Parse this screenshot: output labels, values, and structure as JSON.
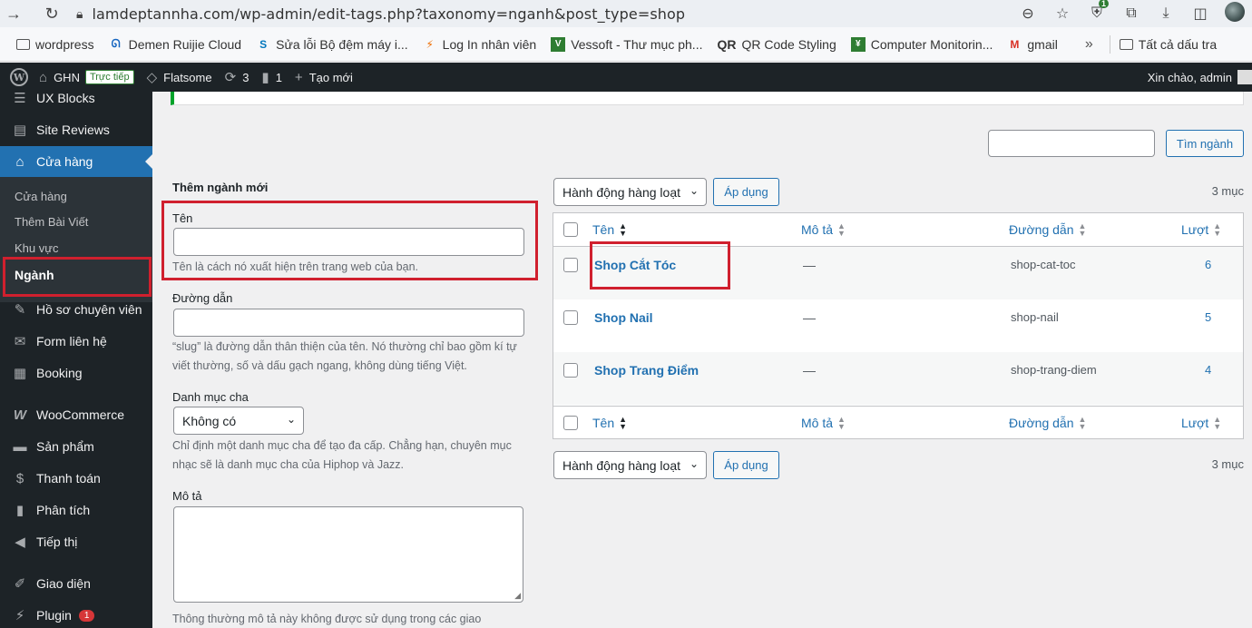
{
  "browser": {
    "url": "lamdeptannha.com/wp-admin/edit-tags.php?taxonomy=nganh&post_type=shop",
    "ext_badge": "1",
    "bookmarks": [
      {
        "label": "wordpress",
        "icon": "folder-icon"
      },
      {
        "label": "Demen Ruijie Cloud",
        "icon": "ruijie-icon"
      },
      {
        "label": "Sửa lỗi Bộ đệm máy i...",
        "icon": "s-logo-icon"
      },
      {
        "label": "Log In nhân viên",
        "icon": "bolt-icon"
      },
      {
        "label": "Vessoft - Thư mục ph...",
        "icon": "vessoft-icon"
      },
      {
        "label": "QR Code Styling",
        "icon": "qr-icon"
      },
      {
        "label": "Computer Monitorin...",
        "icon": "monitor-icon"
      },
      {
        "label": "gmail",
        "icon": "gmail-icon"
      }
    ],
    "bookmarks_more": "»",
    "all_bookmarks": "Tất cả dấu tra"
  },
  "adminbar": {
    "site_name": "GHN",
    "live_label": "Trực tiếp",
    "theme": "Flatsome",
    "updates": "3",
    "comments": "1",
    "new_label": "Tạo mới",
    "howdy": "Xin chào, admin"
  },
  "sidebar": {
    "items": [
      {
        "label": "UX Blocks",
        "icon": "blocks-icon"
      },
      {
        "label": "Site Reviews",
        "icon": "reviews-icon"
      },
      {
        "label": "Cửa hàng",
        "icon": "store-icon"
      },
      {
        "label": "Hồ sơ chuyên viên",
        "icon": "pin-icon"
      },
      {
        "label": "Form liên hệ",
        "icon": "mail-icon"
      },
      {
        "label": "Booking",
        "icon": "calendar-icon"
      },
      {
        "label": "WooCommerce",
        "icon": "woo-icon"
      },
      {
        "label": "Sản phẩm",
        "icon": "archive-icon"
      },
      {
        "label": "Thanh toán",
        "icon": "dollar-icon"
      },
      {
        "label": "Phân tích",
        "icon": "chart-icon"
      },
      {
        "label": "Tiếp thị",
        "icon": "megaphone-icon"
      },
      {
        "label": "Giao diện",
        "icon": "brush-icon"
      },
      {
        "label": "Plugin",
        "icon": "plugin-icon"
      }
    ],
    "plugin_badge": "1",
    "submenu": [
      "Cửa hàng",
      "Thêm Bài Viết",
      "Khu vực",
      "Ngành"
    ]
  },
  "form": {
    "title": "Thêm ngành mới",
    "name_label": "Tên",
    "name_value": "",
    "name_desc": "Tên là cách nó xuất hiện trên trang web của bạn.",
    "slug_label": "Đường dẫn",
    "slug_value": "",
    "slug_desc": "“slug” là đường dẫn thân thiện của tên. Nó thường chỉ bao gồm kí tự viết thường, số và dấu gạch ngang, không dùng tiếng Việt.",
    "parent_label": "Danh mục cha",
    "parent_value": "Không có",
    "parent_desc": "Chỉ định một danh mục cha để tạo đa cấp. Chẳng hạn, chuyên mục nhạc sẽ là danh mục cha của Hiphop và Jazz.",
    "desc_label": "Mô tả",
    "desc_value": "",
    "desc_desc": "Thông thường mô tả này không được sử dụng trong các giao"
  },
  "list": {
    "search_button": "Tìm ngành",
    "bulk_action": "Hành động hàng loạt",
    "apply": "Áp dụng",
    "count": "3 mục",
    "columns": [
      "Tên",
      "Mô tả",
      "Đường dẫn",
      "Lượt"
    ],
    "rows": [
      {
        "name": "Shop Cắt Tóc",
        "desc": "—",
        "slug": "shop-cat-toc",
        "count": "6"
      },
      {
        "name": "Shop Nail",
        "desc": "—",
        "slug": "shop-nail",
        "count": "5"
      },
      {
        "name": "Shop Trang Điểm",
        "desc": "—",
        "slug": "shop-trang-diem",
        "count": "4"
      }
    ]
  },
  "colors": {
    "accent": "#2271b1",
    "highlight": "#d0202e",
    "adminbar": "#1d2327"
  }
}
